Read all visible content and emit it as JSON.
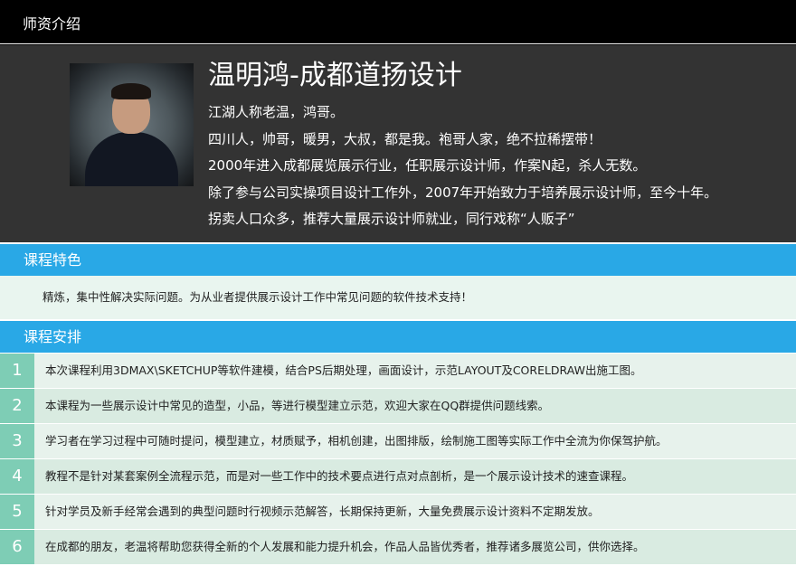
{
  "header": {
    "title": "师资介绍"
  },
  "teacher": {
    "name": "温明鸿-成都道扬设计",
    "bio": [
      "江湖人称老温，鸿哥。",
      "四川人，帅哥，暖男，大叔，都是我。袍哥人家，绝不拉稀摆带！",
      "2000年进入成都展览展示行业，任职展示设计师，作案N起，杀人无数。",
      "除了参与公司实操项目设计工作外，2007年开始致力于培养展示设计师，至今十年。",
      "拐卖人口众多，推荐大量展示设计师就业，同行戏称“人贩子”"
    ]
  },
  "features": {
    "title": "课程特色",
    "text": "精炼，集中性解决实际问题。为从业者提供展示设计工作中常见问题的软件技术支持！"
  },
  "schedule": {
    "title": "课程安排",
    "items": [
      {
        "num": "1",
        "text": "本次课程利用3DMAX\\SKETCHUP等软件建模，结合PS后期处理，画面设计，示范LAYOUT及CORELDRAW出施工图。"
      },
      {
        "num": "2",
        "text": "本课程为一些展示设计中常见的造型，小品，等进行模型建立示范，欢迎大家在QQ群提供问题线索。"
      },
      {
        "num": "3",
        "text": "学习者在学习过程中可随时提问，模型建立，材质赋予，相机创建，出图排版，绘制施工图等实际工作中全流为你保驾护航。"
      },
      {
        "num": "4",
        "text": "教程不是针对某套案例全流程示范，而是对一些工作中的技术要点进行点对点剖析，是一个展示设计技术的速查课程。"
      },
      {
        "num": "5",
        "text": "针对学员及新手经常会遇到的典型问题时行视频示范解答，长期保持更新，大量免费展示设计资料不定期发放。"
      },
      {
        "num": "6",
        "text": "在成都的朋友，老温将帮助您获得全新的个人发展和能力提升机会，作品人品皆优秀者，推荐诸多展览公司，供你选择。"
      }
    ]
  },
  "colors": {
    "topbar": "#000000",
    "teacher_bg": "#333333",
    "section_header": "#29a8e6",
    "number_cell": "#7ecdb5",
    "row_light": "#e7f2ec",
    "row_dark": "#d9ebe1"
  }
}
